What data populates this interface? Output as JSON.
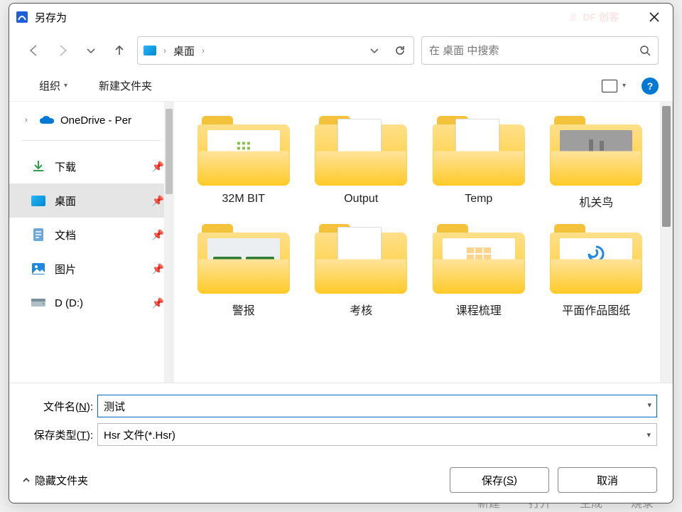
{
  "window": {
    "title": "另存为",
    "watermark": "DF 创客"
  },
  "nav": {
    "breadcrumb": [
      "桌面"
    ],
    "search_placeholder": "在 桌面 中搜索"
  },
  "toolbar": {
    "organize": "组织",
    "new_folder": "新建文件夹"
  },
  "sidebar": {
    "onedrive": "OneDrive - Per",
    "quick": [
      {
        "key": "downloads",
        "label": "下载"
      },
      {
        "key": "desktop",
        "label": "桌面",
        "active": true
      },
      {
        "key": "documents",
        "label": "文档"
      },
      {
        "key": "pictures",
        "label": "图片"
      },
      {
        "key": "drive_d",
        "label": "D (D:)"
      }
    ]
  },
  "folders": [
    {
      "label": "32M BIT",
      "thumb": "dots"
    },
    {
      "label": "Output",
      "thumb": "page"
    },
    {
      "label": "Temp",
      "thumb": "page"
    },
    {
      "label": "机关鸟",
      "thumb": "gray"
    },
    {
      "label": "警报",
      "thumb": "pcb"
    },
    {
      "label": "考核",
      "thumb": "page"
    },
    {
      "label": "课程梳理",
      "thumb": "tiles"
    },
    {
      "label": "平面作品图纸",
      "thumb": "swirl"
    }
  ],
  "form": {
    "filename_label_pre": "文件名(",
    "filename_key": "N",
    "filename_label_post": "):",
    "filename_value": "测试",
    "type_label_pre": "保存类型(",
    "type_key": "T",
    "type_label_post": "):",
    "type_value": "Hsr 文件(*.Hsr)"
  },
  "footer": {
    "hide_folders": "隐藏文件夹",
    "save_pre": "保存(",
    "save_key": "S",
    "save_post": ")",
    "cancel": "取消"
  },
  "backdrop": [
    "新建",
    "打开",
    "生成",
    "烧录"
  ]
}
